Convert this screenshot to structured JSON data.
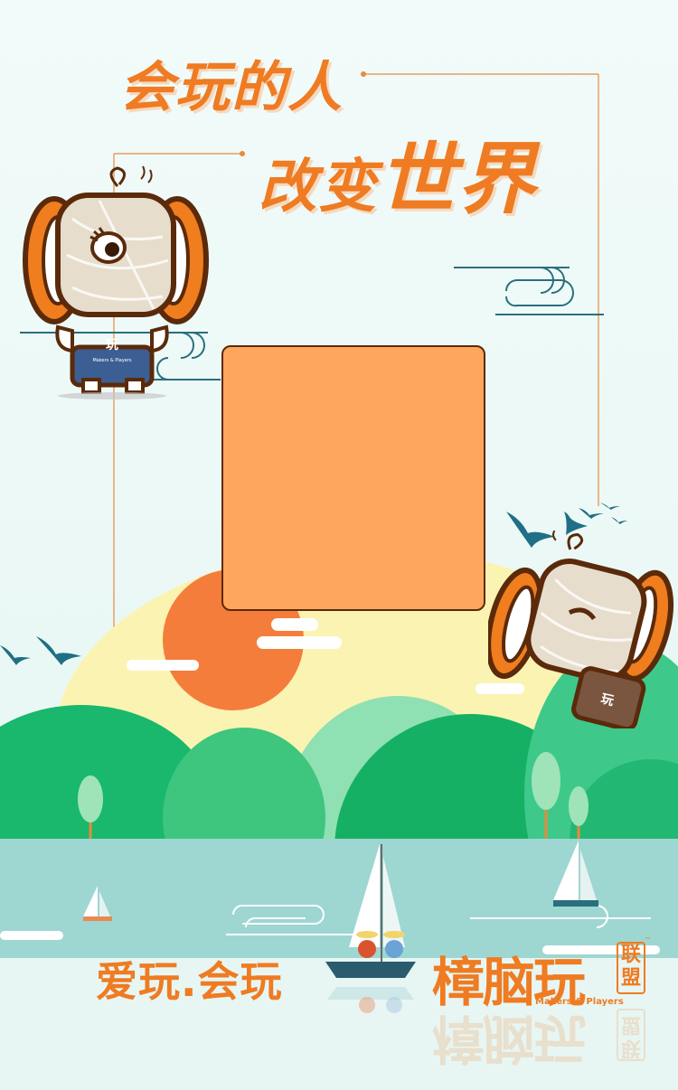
{
  "title": {
    "line1": "会玩的人",
    "line2_prefix": "改变",
    "line2_emphasis": "世界"
  },
  "photo_slot": {
    "color": "#ffa65e"
  },
  "mascot_left": {
    "badge": "玩",
    "badge_small": "Makers & Players"
  },
  "mascot_right": {
    "badge": "玩"
  },
  "slogan": "爱玩.会玩",
  "logo": {
    "name": "樟脑玩",
    "alliance": "联盟",
    "tagline": "Makers & Players",
    "trademark": "™"
  },
  "colors": {
    "accent": "#ef7b22",
    "sun": "#f47d3c",
    "hill_dark": "#12b36a",
    "hill_light": "#5cd396",
    "water": "#9ed6d2",
    "sky": "#eefaf8",
    "bird": "#1f6f86"
  }
}
